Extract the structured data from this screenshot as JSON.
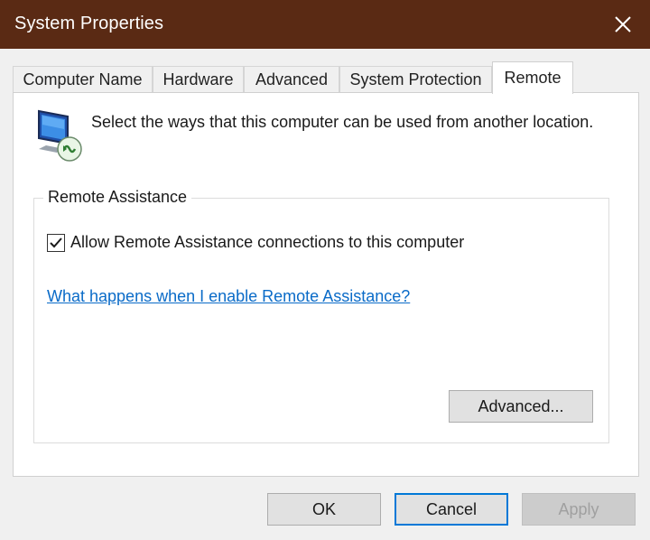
{
  "window": {
    "title": "System Properties",
    "close_icon": "close-icon",
    "colors": {
      "titlebar": "#5a2a14",
      "link": "#0a6bc8",
      "focus_border": "#0078d7"
    }
  },
  "tabs": [
    {
      "label": "Computer Name",
      "active": false
    },
    {
      "label": "Hardware",
      "active": false
    },
    {
      "label": "Advanced",
      "active": false
    },
    {
      "label": "System Protection",
      "active": false
    },
    {
      "label": "Remote",
      "active": true
    }
  ],
  "remote": {
    "icon": "remote-desktop-computer-icon",
    "intro": "Select the ways that this computer can be used from another location.",
    "assistance": {
      "group_label": "Remote Assistance",
      "checkbox_label": "Allow Remote Assistance connections to this computer",
      "checked": true,
      "help_link": "What happens when I enable Remote Assistance?",
      "advanced_button": "Advanced..."
    }
  },
  "footer": {
    "ok": "OK",
    "cancel": "Cancel",
    "apply": "Apply"
  }
}
